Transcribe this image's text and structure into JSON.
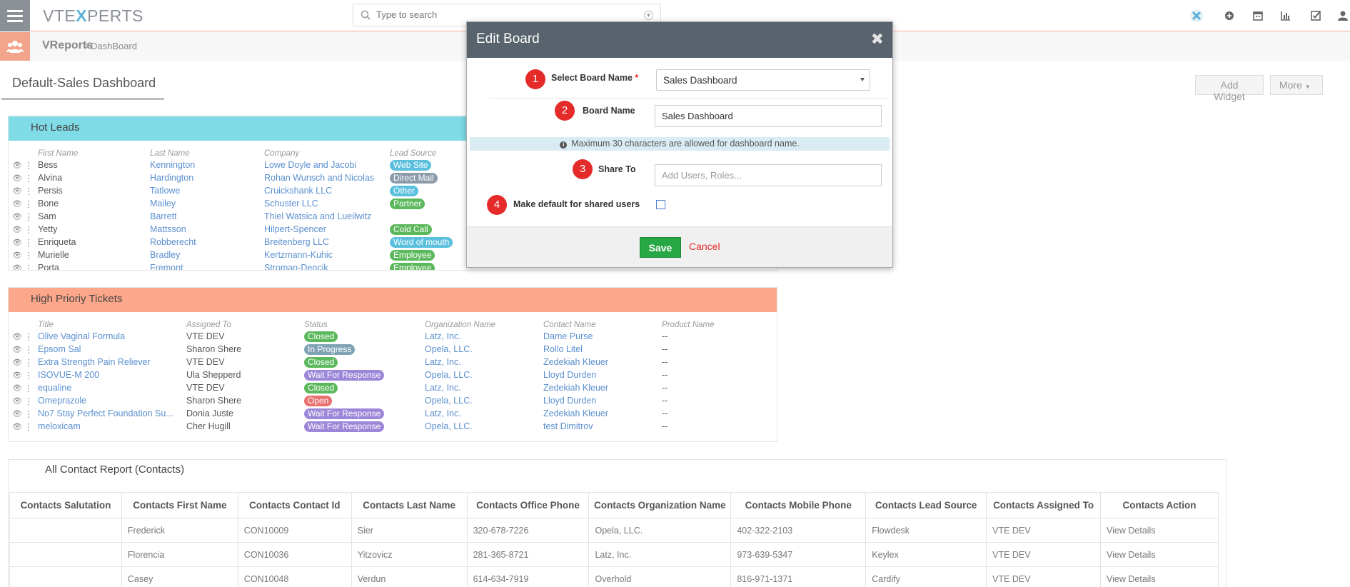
{
  "app": {
    "logo": {
      "pre": "VTE",
      "x": "X",
      "post": "PERTS"
    },
    "search_placeholder": "Type to search"
  },
  "breadcrumb": {
    "module": "VReports",
    "separator": ">",
    "page": "DashBoard"
  },
  "board_tab": "Default-Sales Dashboard",
  "actions": {
    "add_widget": "Add Widget",
    "more": "More"
  },
  "hot_leads": {
    "title": "Hot Leads",
    "header_color": "#7fdbe6",
    "columns": [
      "First Name",
      "Last Name",
      "Company",
      "Lead Source"
    ],
    "rows": [
      {
        "first": "Bess",
        "last": "Kennington",
        "company": "Lowe Doyle and Jacobi",
        "source": "Web Site",
        "color": "#5bc0de"
      },
      {
        "first": "Alvina",
        "last": "Hardington",
        "company": "Rohan Wunsch and Nicolas",
        "source": "Direct Mail",
        "color": "#8b9ba8"
      },
      {
        "first": "Persis",
        "last": "Tatlowe",
        "company": "Cruickshank LLC",
        "source": "Other",
        "color": "#5bc0de"
      },
      {
        "first": "Bone",
        "last": "Mailey",
        "company": "Schuster LLC",
        "source": "Partner",
        "color": "#5cb85c"
      },
      {
        "first": "Sam",
        "last": "Barrett",
        "company": "Thiel Watsica and Lueilwitz",
        "source": "",
        "color": ""
      },
      {
        "first": "Yetty",
        "last": "Mattsson",
        "company": "Hilpert-Spencer",
        "source": "Cold Call",
        "color": "#5cb85c"
      },
      {
        "first": "Enriqueta",
        "last": "Robberecht",
        "company": "Breitenberg LLC",
        "source": "Word of mouth",
        "color": "#5bc0de"
      },
      {
        "first": "Murielle",
        "last": "Bradley",
        "company": "Kertzmann-Kuhic",
        "source": "Employee",
        "color": "#5cb85c"
      },
      {
        "first": "Porta",
        "last": "Fremont",
        "company": "Stroman-Dencik",
        "source": "Employee",
        "color": "#5cb85c"
      }
    ]
  },
  "tickets": {
    "title": "High Prioriy Tickets",
    "header_color": "#fda78a",
    "columns": [
      "Title",
      "Assigned To",
      "Status",
      "Organization Name",
      "Contact Name",
      "Product Name"
    ],
    "rows": [
      {
        "title": "Olive Vaginal Formula",
        "assigned": "VTE DEV",
        "status": "Closed",
        "color": "#5cb85c",
        "org": "Latz, Inc.",
        "contact": "Dame Purse",
        "product": "--"
      },
      {
        "title": "Epsom Sal",
        "assigned": "Sharon Shere",
        "status": "In Progress",
        "color": "#7fa3b5",
        "org": "Opela, LLC.",
        "contact": "Rollo Litel",
        "product": "--"
      },
      {
        "title": "Extra Strength Pain Reliever",
        "assigned": "VTE DEV",
        "status": "Closed",
        "color": "#5cb85c",
        "org": "Latz, Inc.",
        "contact": "Zedekiah Kleuer",
        "product": "--"
      },
      {
        "title": "ISOVUE-M 200",
        "assigned": "Ula Shepperd",
        "status": "Wait For Response",
        "color": "#9b86d8",
        "org": "Opela, LLC.",
        "contact": "Lloyd Durden",
        "product": "--"
      },
      {
        "title": "equaline",
        "assigned": "VTE DEV",
        "status": "Closed",
        "color": "#5cb85c",
        "org": "Latz, Inc.",
        "contact": "Zedekiah Kleuer",
        "product": "--"
      },
      {
        "title": "Omeprazole",
        "assigned": "Sharon Shere",
        "status": "Open",
        "color": "#e87070",
        "org": "Opela, LLC.",
        "contact": "Lloyd Durden",
        "product": "--"
      },
      {
        "title": "No7 Stay Perfect Foundation Su...",
        "assigned": "Donia Juste",
        "status": "Wait For Response",
        "color": "#9b86d8",
        "org": "Latz, Inc.",
        "contact": "Zedekiah Kleuer",
        "product": "--"
      },
      {
        "title": "meloxicam",
        "assigned": "Cher Hugill",
        "status": "Wait For Response",
        "color": "#9b86d8",
        "org": "Opela, LLC.",
        "contact": "test Dimitrov",
        "product": "--"
      }
    ]
  },
  "contact_report": {
    "title": "All Contact Report (Contacts)",
    "columns": [
      "Contacts Salutation",
      "Contacts First Name",
      "Contacts Contact Id",
      "Contacts Last Name",
      "Contacts Office Phone",
      "Contacts Organization Name",
      "Contacts Mobile Phone",
      "Contacts Lead Source",
      "Contacts Assigned To",
      "Contacts Action"
    ],
    "rows": [
      [
        "",
        "Frederick",
        "CON10009",
        "Sier",
        "320-678-7226",
        "Opela, LLC.",
        "402-322-2103",
        "Flowdesk",
        "VTE DEV",
        "View Details"
      ],
      [
        "",
        "Florencia",
        "CON10036",
        "Yitzovicz",
        "281-365-8721",
        "Latz, Inc.",
        "973-639-5347",
        "Keylex",
        "VTE DEV",
        "View Details"
      ],
      [
        "",
        "Casey",
        "CON10048",
        "Verdun",
        "614-634-7919",
        "Overhold",
        "816-971-1371",
        "Cardify",
        "VTE DEV",
        "View Details"
      ]
    ]
  },
  "modal": {
    "title": "Edit Board",
    "close": "✖",
    "select_label": "Select Board Name",
    "required_mark": "*",
    "select_value": "Sales Dashboard",
    "name_label": "Board Name",
    "name_value": "Sales Dashboard",
    "note": "Maximum 30 characters are allowed for dashboard name.",
    "share_label": "Share To",
    "share_placeholder": "Add Users, Roles...",
    "default_label": "Make default for shared users",
    "save": "Save",
    "cancel": "Cancel",
    "steps": [
      "1",
      "2",
      "3",
      "4"
    ]
  }
}
